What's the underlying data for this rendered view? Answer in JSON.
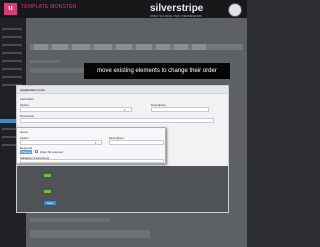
{
  "brand": {
    "logo_letter": "ʊ",
    "name": "TEMPLATE MONSTER"
  },
  "product": {
    "name": "silverstripe",
    "tagline": "OPEN SOURCE CMS / FRAMEWORK"
  },
  "colors": {
    "accent": "#d43f7a",
    "primary_button": "#3a8dd1",
    "add_button": "#6bbf3a"
  },
  "banner": {
    "text": "move existing elements to change their order"
  },
  "form": {
    "title": "Application Form",
    "field_label": "Field label",
    "option_label": "Option",
    "description_label": "Description",
    "dimension_label": "Dimension",
    "selected": "Hide"
  },
  "drag_item": {
    "name_label": "Name",
    "description_label": "Description",
    "option_label": "Option",
    "required_label": "Required",
    "button_label": "Change",
    "checkbox_label": "Hide this element",
    "section_label": "Validation Instructions"
  },
  "actions": {
    "save_label": "Save"
  }
}
